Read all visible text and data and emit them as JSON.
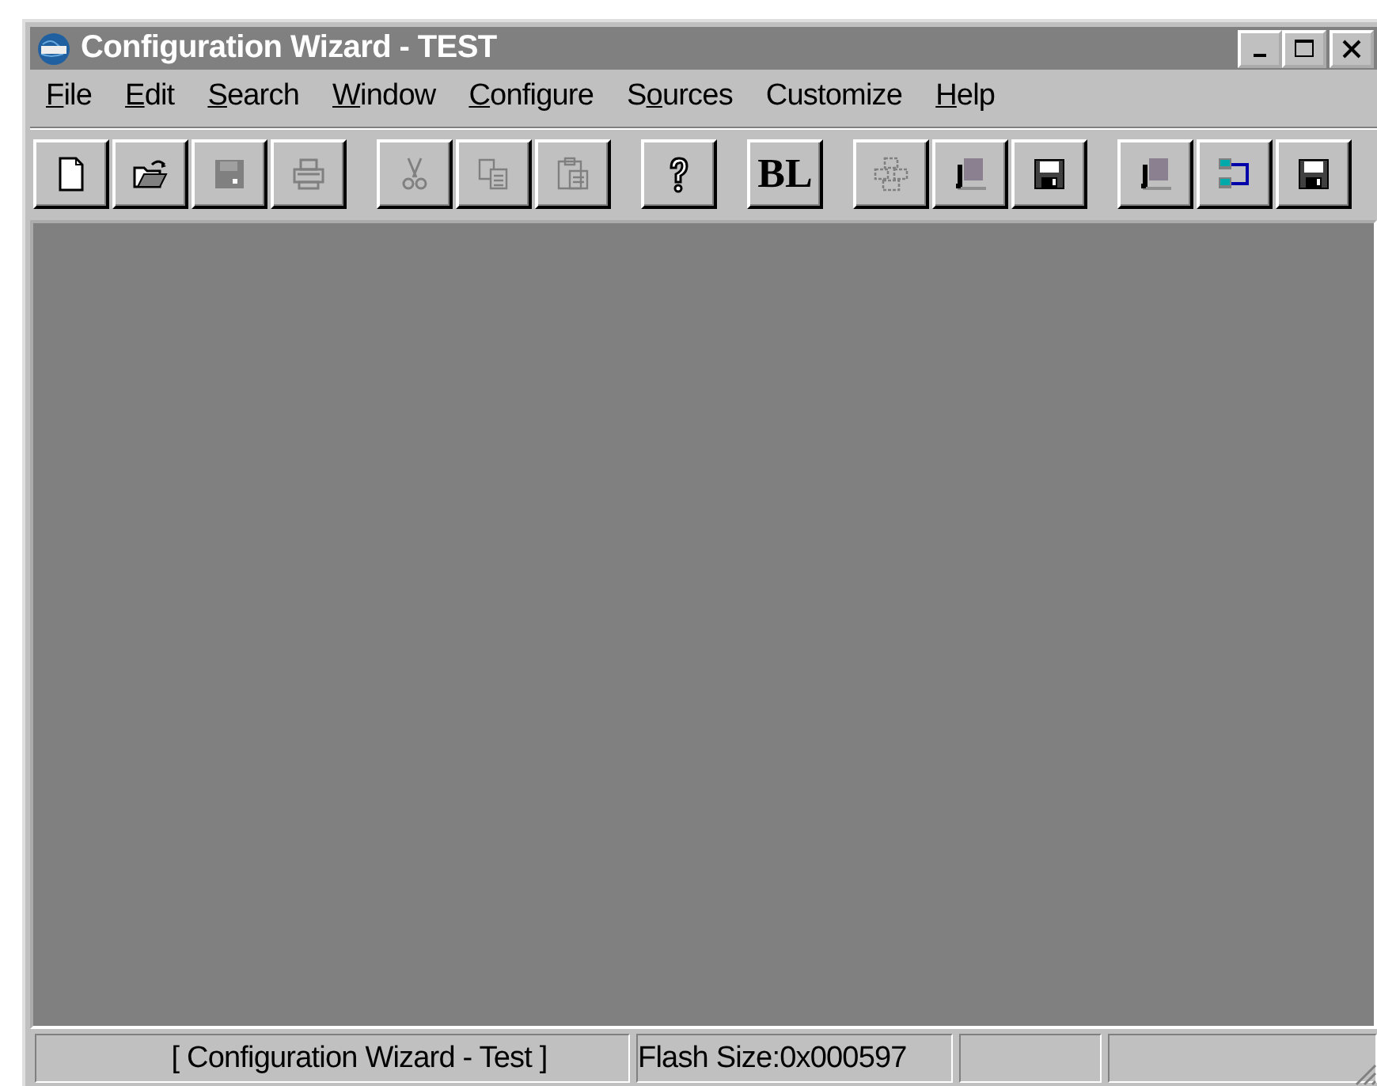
{
  "window": {
    "title": "Configuration Wizard - TEST",
    "active": false
  },
  "menu": [
    {
      "label": "File",
      "kind": "first"
    },
    {
      "label": "Edit",
      "kind": "first"
    },
    {
      "label": "Search",
      "kind": "first"
    },
    {
      "label": "Window",
      "kind": "first"
    },
    {
      "label": "Configure",
      "kind": "first"
    },
    {
      "label": "Sources",
      "kind": "second"
    },
    {
      "label": "Customize",
      "kind": "plain"
    },
    {
      "label": "Help",
      "kind": "first"
    }
  ],
  "toolbar": [
    [
      {
        "kind": "new",
        "disabled": false
      },
      {
        "kind": "open",
        "disabled": false
      },
      {
        "kind": "save",
        "disabled": true
      },
      {
        "kind": "print",
        "disabled": true
      }
    ],
    [
      {
        "kind": "cut",
        "disabled": true
      },
      {
        "kind": "copy",
        "disabled": true
      },
      {
        "kind": "paste",
        "disabled": true
      }
    ],
    [
      {
        "kind": "help",
        "disabled": false
      }
    ],
    [
      {
        "kind": "text",
        "label": "BL",
        "disabled": false
      }
    ],
    [
      {
        "kind": "cluster",
        "disabled": true
      },
      {
        "kind": "computer",
        "disabled": true
      },
      {
        "kind": "save",
        "disabled": false
      }
    ],
    [
      {
        "kind": "computer",
        "disabled": true
      },
      {
        "kind": "network",
        "disabled": false
      },
      {
        "kind": "save",
        "disabled": false
      }
    ]
  ],
  "status_bar": [
    "[ Configuration Wizard - Test ]",
    "Flash Size:0x000597"
  ]
}
